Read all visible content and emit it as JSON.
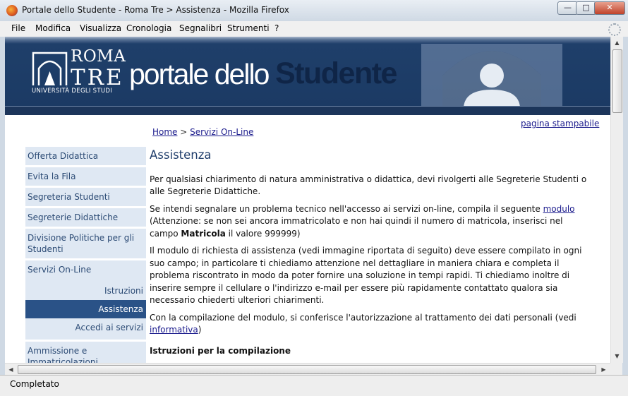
{
  "window": {
    "title": "Portale dello Studente - Roma Tre > Assistenza - Mozilla Firefox",
    "minimize": "—",
    "maximize": "□",
    "close": "✕"
  },
  "menu": [
    "File",
    "Modifica",
    "Visualizza",
    "Cronologia",
    "Segnalibri",
    "Strumenti",
    "?"
  ],
  "banner": {
    "logo_line1": "ROMA",
    "logo_line2": "TRE",
    "logo_sub": "UNIVERSITÀ DEGLI STUDI",
    "brand_light": "portale dello",
    "brand_bold": "Studente"
  },
  "print_link": "pagina stampabile",
  "breadcrumb": {
    "home": "Home",
    "sep": " > ",
    "current": "Servizi On-Line"
  },
  "sidebar": {
    "items": [
      "Offerta Didattica",
      "Evita la Fila",
      "Segreteria Studenti",
      "Segreterie Didattiche",
      "Divisione Politiche per gli Studenti",
      "Servizi On-Line"
    ],
    "subitems": [
      "Istruzioni",
      "Assistenza",
      "Accedi ai servizi"
    ],
    "after": [
      "Ammissione e Immatricolazioni"
    ]
  },
  "content": {
    "title": "Assistenza",
    "p1": "Per qualsiasi chiarimento di natura amministrativa o didattica, devi rivolgerti alle Segreterie Studenti o alle Segreterie Didattiche.",
    "p2_a": "Se intendi segnalare un problema tecnico nell'accesso ai servizi on-line, compila il seguente ",
    "p2_link": "modulo",
    "p2_b": " (Attenzione: se non sei ancora immatricolato e non hai quindi il numero di matricola, inserisci nel campo ",
    "p2_bold": "Matricola",
    "p2_c": " il valore 999999)",
    "p3": "Il modulo di richiesta di assistenza (vedi immagine riportata di seguito) deve essere compilato in ogni suo campo; in particolare ti chiediamo attenzione nel dettagliare in maniera chiara e completa il problema riscontrato in modo da poter fornire una soluzione in tempi rapidi. Ti chiediamo inoltre di inserire sempre il cellulare o l'indirizzo e-mail per essere più rapidamente contattato qualora sia necessario chiederti ulteriori chiarimenti.",
    "p4_a": "Con la compilazione del modulo, si conferisce l'autorizzazione al trattamento dei dati personali (vedi ",
    "p4_link": "informativa",
    "p4_b": ")",
    "subheading": "Istruzioni per la compilazione"
  },
  "status": "Completato"
}
